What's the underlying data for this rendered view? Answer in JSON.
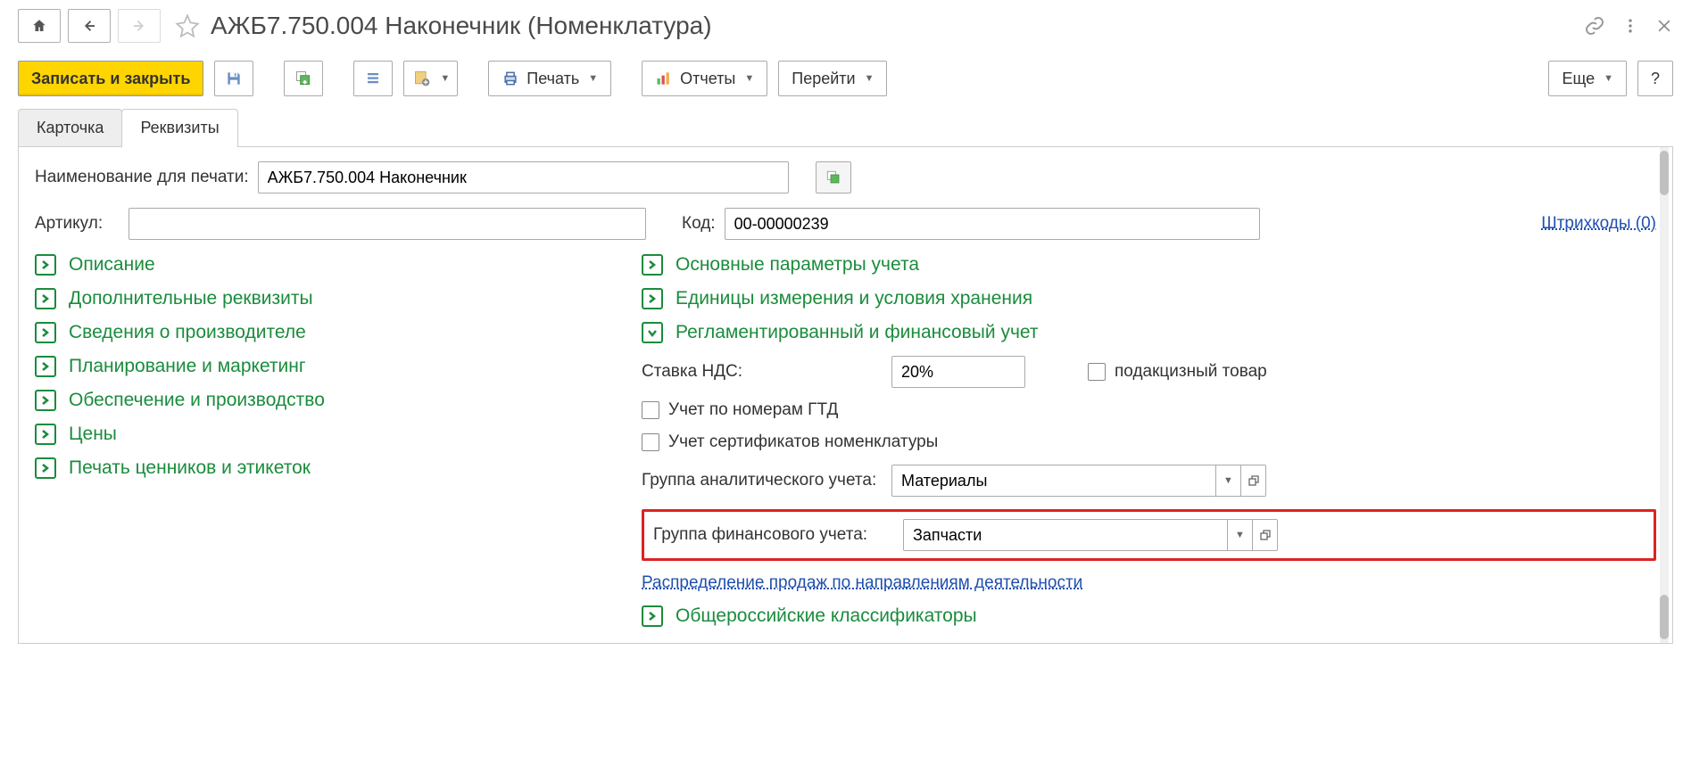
{
  "title": "АЖБ7.750.004 Наконечник (Номенклатура)",
  "toolbar": {
    "save_close": "Записать и закрыть",
    "print": "Печать",
    "reports": "Отчеты",
    "goto": "Перейти",
    "more": "Еще",
    "help": "?"
  },
  "tabs": {
    "card": "Карточка",
    "props": "Реквизиты"
  },
  "form": {
    "print_name_label": "Наименование для печати:",
    "print_name_value": "АЖБ7.750.004 Наконечник",
    "article_label": "Артикул:",
    "article_value": "",
    "code_label": "Код:",
    "code_value": "00-00000239",
    "barcodes_link": "Штрихкоды (0)"
  },
  "sections_left": [
    "Описание",
    "Дополнительные реквизиты",
    "Сведения о производителе",
    "Планирование и маркетинг",
    "Обеспечение и производство",
    "Цены",
    "Печать ценников и этикеток"
  ],
  "sections_right": {
    "main_params": "Основные параметры учета",
    "units": "Единицы измерения и условия хранения",
    "regfin": "Регламентированный и финансовый учет",
    "vat_label": "Ставка НДС:",
    "vat_value": "20%",
    "excise": "подакцизный товар",
    "gtd": "Учет по номерам ГТД",
    "cert": "Учет сертификатов номенклатуры",
    "analytic_label": "Группа аналитического учета:",
    "analytic_value": "Материалы",
    "financial_label": "Группа финансового учета:",
    "financial_value": "Запчасти",
    "sales_link": "Распределение продаж по направлениям деятельности",
    "classifiers": "Общероссийские классификаторы"
  }
}
